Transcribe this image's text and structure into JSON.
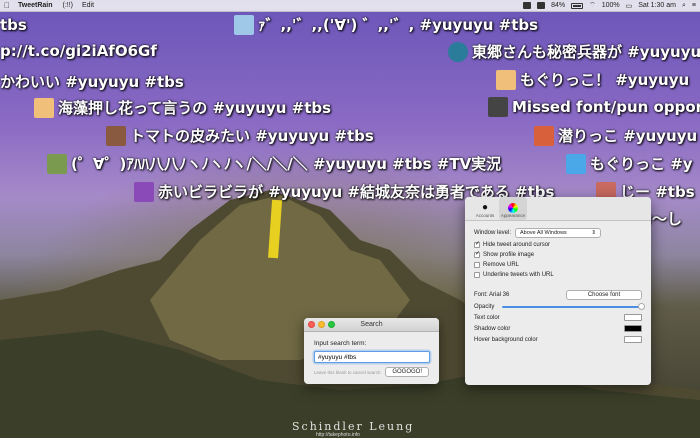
{
  "menubar": {
    "app_name": "TweetRain",
    "items": [
      "(:!!)",
      "Edit"
    ],
    "battery": "84%",
    "wifi_pct": "100%",
    "clock": "Sat 1:30 am"
  },
  "tweets": [
    {
      "text": "tbs",
      "avatar": null,
      "color": null
    },
    {
      "text": "ｧ゛,,'゛,,('∀') ゛,,'゛, #yuyuyu #tbs",
      "avatar": "icon-anime-girl",
      "color": "#9ec7e8"
    },
    {
      "text": "p://t.co/gi2iAfO6Gf",
      "avatar": null,
      "color": null
    },
    {
      "text": "東郷さんも秘密兵器が #yuyuyu",
      "avatar": "icon-logo",
      "color": "#2b7b9a"
    },
    {
      "text": "かわいい #yuyuyu #tbs",
      "avatar": null,
      "color": null
    },
    {
      "text": "もぐりっこ！ #yuyuyu",
      "avatar": "icon-sunset",
      "color": "#f0c07a"
    },
    {
      "text": "海藻押し花って言うの #yuyuyu #tbs",
      "avatar": "icon-sunset",
      "color": "#f0c07a"
    },
    {
      "text": "Missed font/pun oppor",
      "avatar": "icon-character",
      "color": "#444444"
    },
    {
      "text": "トマトの皮みたい #yuyuyu #tbs",
      "avatar": "icon-brown-hair",
      "color": "#8a5a40"
    },
    {
      "text": "潜りっこ #yuyuyu",
      "avatar": "icon-red-hair",
      "color": "#d8603a"
    },
    {
      "text": "(゜∀゜)ｱﾊﾊ八八ﾉヽﾉヽﾉヽ/＼/＼/＼ #yuyuyu #tbs #TV実況",
      "avatar": "icon-green",
      "color": "#7a9a50"
    },
    {
      "text": "もぐりっこ #y",
      "avatar": "icon-blue",
      "color": "#4aa8e8"
    },
    {
      "text": "赤いビラビラが #yuyuyu #結城友奈は勇者である #tbs",
      "avatar": "icon-egg",
      "color": "#8a4ab8"
    },
    {
      "text": "じー #tbs",
      "avatar": "icon-red-girl",
      "color": "#c86a60"
    },
    {
      "text": "よお〜し",
      "avatar": "icon-pink",
      "color": "#d88ab8"
    }
  ],
  "search_window": {
    "title": "Search",
    "label": "Input search term:",
    "value": "#yuyuyu #tbs",
    "hint": "Leave this blank to cancel search",
    "button": "GOGOGO!"
  },
  "prefs_window": {
    "tabs": [
      "Accounts",
      "Appearance"
    ],
    "window_level_label": "Window level:",
    "window_level_value": "Above All Windows",
    "checkboxes": [
      {
        "label": "Hide tweet around cursor",
        "checked": true
      },
      {
        "label": "Show profile image",
        "checked": true
      },
      {
        "label": "Remove URL",
        "checked": false
      },
      {
        "label": "Underline tweets with URL",
        "checked": false
      }
    ],
    "font_label": "Font: Arial 36",
    "choose_font": "Choose font",
    "opacity_label": "Opacity",
    "opacity_value": 1.0,
    "text_color_label": "Text color",
    "text_color": "#ffffff",
    "shadow_color_label": "Shadow color",
    "shadow_color": "#000000",
    "hover_bg_label": "Hover background color",
    "hover_bg_color": "#ffffff"
  },
  "watermark": {
    "name": "Schindler Leung",
    "url": "http://takephoto.info"
  }
}
